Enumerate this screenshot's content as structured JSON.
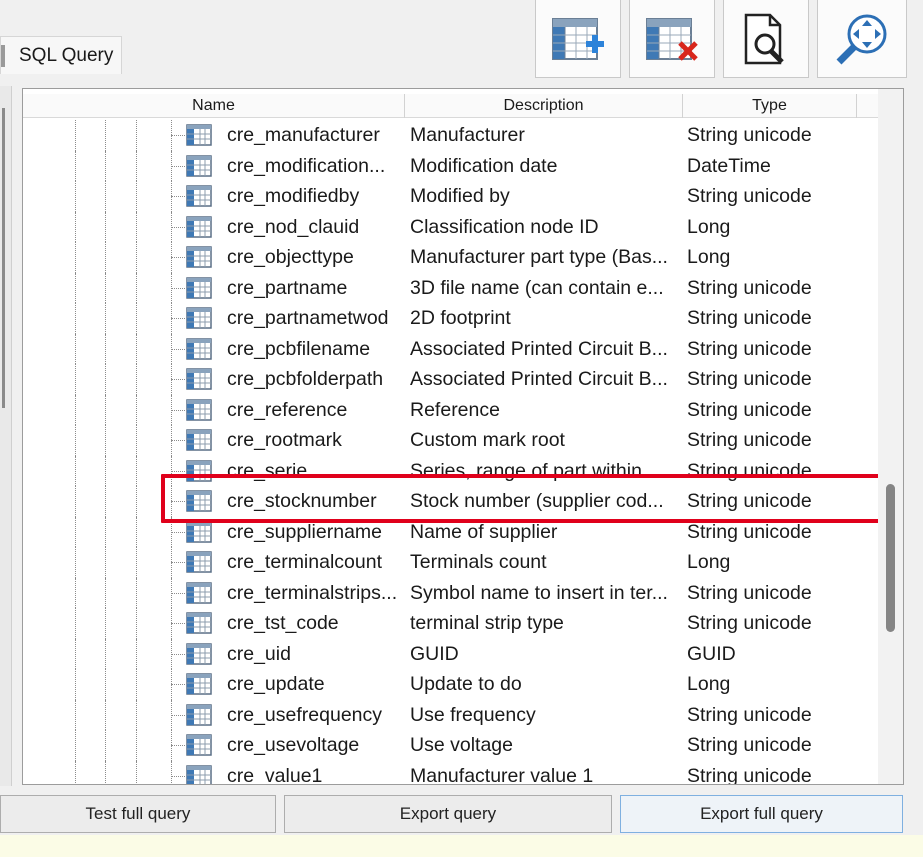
{
  "tab": {
    "label": "SQL Query"
  },
  "toolbar": [
    {
      "name": "add-field-button",
      "icon": "table-add-icon"
    },
    {
      "name": "remove-field-button",
      "icon": "table-delete-icon"
    },
    {
      "name": "preview-button",
      "icon": "document-search-icon"
    },
    {
      "name": "zoom-fit-button",
      "icon": "zoom-arrows-icon"
    }
  ],
  "columns": {
    "name": "Name",
    "description": "Description",
    "type": "Type"
  },
  "rows": [
    {
      "name": "cre_manufacturer",
      "description": "Manufacturer",
      "type": "String unicode"
    },
    {
      "name": "cre_modification...",
      "description": "Modification date",
      "type": "DateTime"
    },
    {
      "name": "cre_modifiedby",
      "description": "Modified by",
      "type": "String unicode"
    },
    {
      "name": "cre_nod_clauid",
      "description": "Classification node ID",
      "type": "Long"
    },
    {
      "name": "cre_objecttype",
      "description": "Manufacturer part type (Bas...",
      "type": "Long"
    },
    {
      "name": "cre_partname",
      "description": "3D file name (can contain e...",
      "type": "String unicode"
    },
    {
      "name": "cre_partnametwod",
      "description": "2D footprint",
      "type": "String unicode"
    },
    {
      "name": "cre_pcbfilename",
      "description": "Associated Printed Circuit B...",
      "type": "String unicode"
    },
    {
      "name": "cre_pcbfolderpath",
      "description": "Associated Printed Circuit B...",
      "type": "String unicode"
    },
    {
      "name": "cre_reference",
      "description": "Reference",
      "type": "String unicode"
    },
    {
      "name": "cre_rootmark",
      "description": "Custom mark root",
      "type": "String unicode"
    },
    {
      "name": "cre_serie",
      "description": "Series, range of part within ...",
      "type": "String unicode"
    },
    {
      "name": "cre_stocknumber",
      "description": "Stock number (supplier cod...",
      "type": "String unicode"
    },
    {
      "name": "cre_suppliername",
      "description": "Name of supplier",
      "type": "String unicode"
    },
    {
      "name": "cre_terminalcount",
      "description": "Terminals count",
      "type": "Long"
    },
    {
      "name": "cre_terminalstrips...",
      "description": "Symbol name to insert in ter...",
      "type": "String unicode"
    },
    {
      "name": "cre_tst_code",
      "description": "terminal strip type",
      "type": "String unicode"
    },
    {
      "name": "cre_uid",
      "description": "GUID",
      "type": "GUID"
    },
    {
      "name": "cre_update",
      "description": "Update to do",
      "type": "Long"
    },
    {
      "name": "cre_usefrequency",
      "description": "Use frequency",
      "type": "String unicode"
    },
    {
      "name": "cre_usevoltage",
      "description": "Use voltage",
      "type": "String unicode"
    },
    {
      "name": "cre_value1",
      "description": "Manufacturer value 1",
      "type": "String unicode"
    }
  ],
  "highlighted_row": "cre_reference",
  "highlight_color": "#e0001b",
  "buttons": {
    "test_full_query": "Test full query",
    "export_query": "Export query",
    "export_full_query": "Export full query"
  }
}
